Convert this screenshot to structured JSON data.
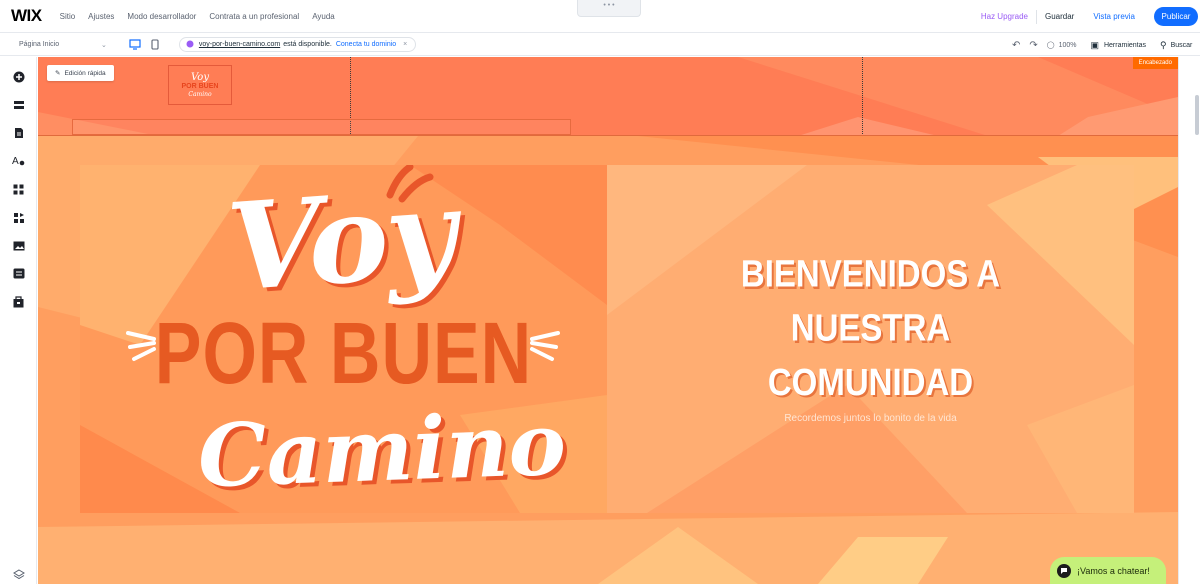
{
  "app": {
    "logo": "WIX",
    "menu": [
      "Sitio",
      "Ajustes",
      "Modo desarrollador",
      "Contrata a un profesional",
      "Ayuda"
    ],
    "upgrade_label": "Haz Upgrade",
    "save_label": "Guardar",
    "preview_label": "Vista previa",
    "publish_label": "Publicar"
  },
  "toolbar": {
    "page_selector": "Página Inicio",
    "domain": "voy-por-buen-camino.com",
    "domain_status": "está disponible.",
    "connect_domain": "Conecta tu dominio",
    "zoom": "100%",
    "tools_label": "Herramientas",
    "search_label": "Buscar"
  },
  "header": {
    "quick_edit": "Edición rápida",
    "section_badge": "Encabezado",
    "logo_line1": "Voy",
    "logo_line2": "POR BUEN",
    "logo_line3": "Camino"
  },
  "hero": {
    "title_line1": "Voy",
    "title_line2": "POR BUEN",
    "title_line3": "Camino",
    "welcome_line1": "BIENVENIDOS A",
    "welcome_line2": "NUESTRA",
    "welcome_line3": "COMUNIDAD",
    "tagline": "Recordemos juntos lo bonito de la vida"
  },
  "chat": {
    "label": "¡Vamos a chatear!"
  },
  "colors": {
    "accent": "#116dff",
    "header_bg": "#ff7d55",
    "page_bg": "#ffa062",
    "brand_orange": "#e65a22",
    "chat_bg": "#c5f07a",
    "upgrade": "#9a5cf5"
  },
  "icons": {
    "sidebar": [
      "add-icon",
      "sections-icon",
      "pages-icon",
      "design-icon",
      "apps-icon",
      "business-icon",
      "media-icon",
      "cms-icon",
      "portfolio-icon",
      "layers-icon"
    ]
  }
}
